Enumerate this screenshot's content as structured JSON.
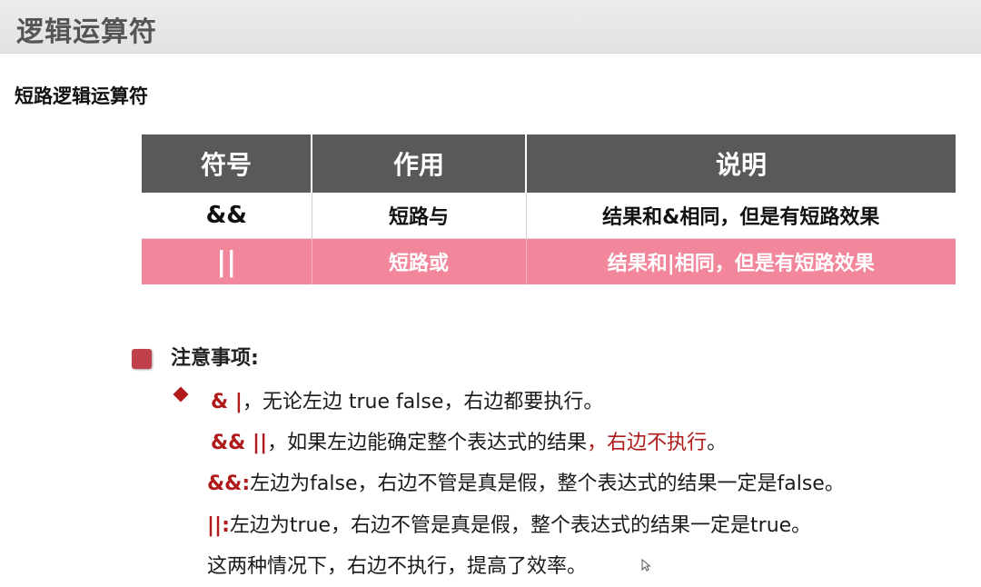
{
  "header": {
    "title": "逻辑运算符"
  },
  "section": {
    "subtitle": "短路逻辑运算符"
  },
  "table": {
    "headers": [
      "符号",
      "作用",
      "说明"
    ],
    "rows": [
      {
        "symbol": "&&",
        "role": "短路与",
        "desc": "结果和&相同，但是有短路效果"
      },
      {
        "symbol": "||",
        "role": "短路或",
        "desc": "结果和|相同，但是有短路效果"
      }
    ]
  },
  "notes": {
    "title": "注意事项:",
    "line1": {
      "op": "& |",
      "text": "，无论左边 true false，右边都要执行。"
    },
    "line2": {
      "op": "&& ||",
      "text": "，如果左边能确定整个表达式的结果",
      "emphasis": "，右边不执行",
      "end": "。"
    },
    "line3": {
      "op": "&&:",
      "text": "左边为false，右边不管是真是假，整个表达式的结果一定是false。"
    },
    "line4": {
      "op": "||:",
      "text": "左边为true，右边不管是真是假，整个表达式的结果一定是true。"
    },
    "line5": {
      "text": "这两种情况下，右边不执行，提高了效率。"
    }
  },
  "colors": {
    "header_bar": "#595959",
    "highlight_row": "#f2879b",
    "accent_red": "#b01a1a",
    "note_box": "#c0414b"
  }
}
